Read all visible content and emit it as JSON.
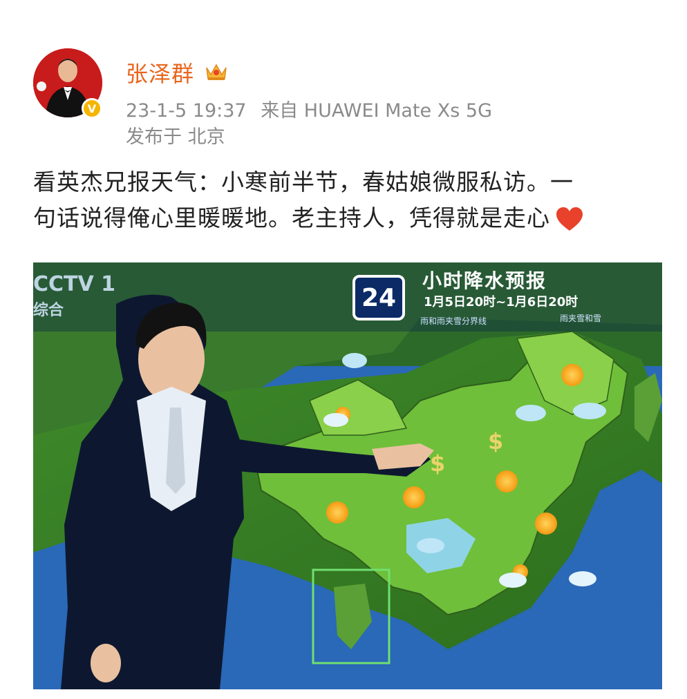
{
  "post": {
    "author_name": "张泽群",
    "timestamp": "23-1-5 19:37",
    "source": "来自 HUAWEI Mate Xs 5G",
    "location": "发布于 北京",
    "text_line1": "看英杰兄报天气：小寒前半节，春姑娘微服私访。一",
    "text_line2": "句话说得俺心里暖暖地。老主持人，凭得就是走心",
    "verified_badge": "V"
  },
  "broadcast": {
    "channel_logo": "CCTV 1",
    "channel_sub": "综合",
    "hours_badge": "24",
    "title": "小时降水预报",
    "time_range": "1月5日20时~1月6日20时",
    "legend_left": "雨和雨夹雪分界线",
    "legend_right": "雨夹雪和雪"
  },
  "icons": {
    "crown": "crown-icon",
    "heart": "heart-icon",
    "verified": "verified-icon"
  },
  "colors": {
    "name": "#e8651c",
    "meta": "#8a8a8a",
    "heart": "#e8412c",
    "badge": "#f5b500"
  }
}
